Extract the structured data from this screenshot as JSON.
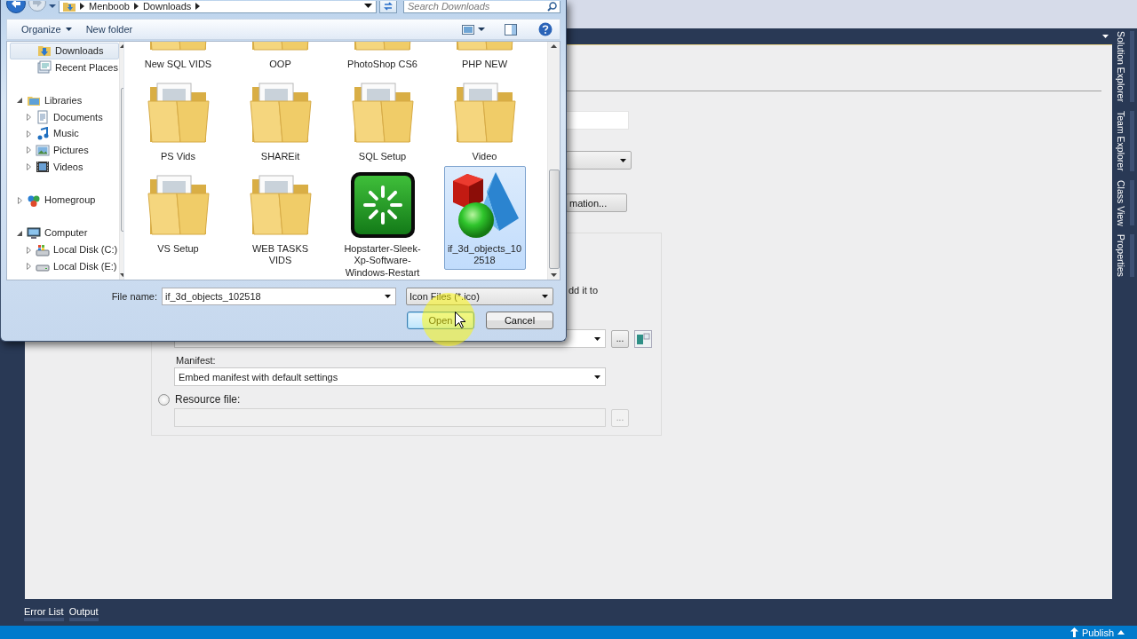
{
  "ide": {
    "vertical_tabs": [
      "Solution Explorer",
      "Team Explorer",
      "Class View",
      "Properties"
    ],
    "page": {
      "partial_button": "mation...",
      "partial_label": "dd it to",
      "browse_button": "...",
      "manifest": {
        "label": "Manifest:",
        "value": "Embed manifest with default settings"
      },
      "resource_file": {
        "label": "Resource file:",
        "selected": false,
        "disabled": true,
        "browse_button": "..."
      }
    },
    "bottom_tabs": [
      "Error List",
      "Output"
    ],
    "status_bar": {
      "publish": "Publish"
    }
  },
  "dialog": {
    "breadcrumb": [
      "Menboob",
      "Downloads"
    ],
    "search": {
      "placeholder": "Search Downloads"
    },
    "toolbar": [
      {
        "label": "Organize",
        "menu": true
      },
      {
        "label": "New folder",
        "menu": false
      }
    ],
    "nav": {
      "favorites": [
        {
          "label": "Downloads",
          "selected": true
        },
        {
          "label": "Recent Places",
          "selected": false
        }
      ],
      "tree": [
        {
          "label": "Libraries",
          "expanded": true,
          "selected": false,
          "children": [
            {
              "label": "Documents",
              "expanded": false,
              "selected": false
            },
            {
              "label": "Music",
              "expanded": false,
              "selected": false
            },
            {
              "label": "Pictures",
              "expanded": false,
              "selected": false
            },
            {
              "label": "Videos",
              "expanded": false,
              "selected": false
            }
          ]
        },
        {
          "label": "Homegroup",
          "expanded": false,
          "selected": false
        },
        {
          "label": "Computer",
          "expanded": true,
          "selected": false,
          "children": [
            {
              "label": "Local Disk (C:)",
              "expanded": false,
              "selected": false
            },
            {
              "label": "Local Disk (E:)",
              "expanded": false,
              "selected": false
            }
          ]
        }
      ]
    },
    "items": [
      {
        "label": "New SQL VIDS",
        "kind": "folder",
        "selected": false
      },
      {
        "label": "OOP",
        "kind": "folder",
        "selected": false
      },
      {
        "label": "PhotoShop CS6",
        "kind": "folder",
        "selected": false
      },
      {
        "label": "PHP NEW",
        "kind": "folder",
        "selected": false
      },
      {
        "label": "PS Vids",
        "kind": "folder",
        "selected": false
      },
      {
        "label": "SHAREit",
        "kind": "folder",
        "selected": false
      },
      {
        "label": "SQL Setup",
        "kind": "folder",
        "selected": false
      },
      {
        "label": "Video",
        "kind": "folder",
        "selected": false
      },
      {
        "label": "VS Setup",
        "kind": "folder",
        "selected": false
      },
      {
        "label": "WEB TASKS VIDS",
        "kind": "folder",
        "selected": false
      },
      {
        "label": "Hopstarter-Sleek-Xp-Software-Windows-Restart",
        "kind": "restart",
        "selected": false
      },
      {
        "label": "if_3d_objects_102518",
        "kind": "shapes",
        "selected": true
      }
    ],
    "file_name": {
      "label": "File name:",
      "value": "if_3d_objects_102518"
    },
    "file_type": "Icon Files (*.ico)",
    "buttons": [
      {
        "label": "Open",
        "kind": "default"
      },
      {
        "label": "Cancel",
        "kind": "normal"
      }
    ]
  }
}
